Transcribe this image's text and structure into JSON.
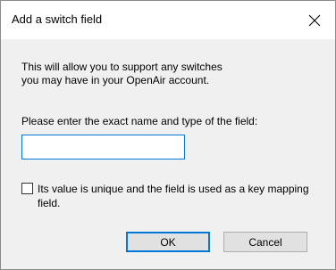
{
  "dialog": {
    "title": "Add a switch field",
    "close_icon": "close-icon",
    "info_text": "This will allow you to support any switches\nyou may have in your OpenAir account.",
    "prompt_text": "Please enter the exact name and type of the field:",
    "name_field": {
      "value": "",
      "placeholder": ""
    },
    "key_checkbox": {
      "checked": false,
      "label": "Its value is unique and the field is used as a key mapping field."
    },
    "buttons": {
      "ok": "OK",
      "cancel": "Cancel"
    },
    "colors": {
      "accent": "#0078d7",
      "face": "#f0f0f0"
    }
  }
}
